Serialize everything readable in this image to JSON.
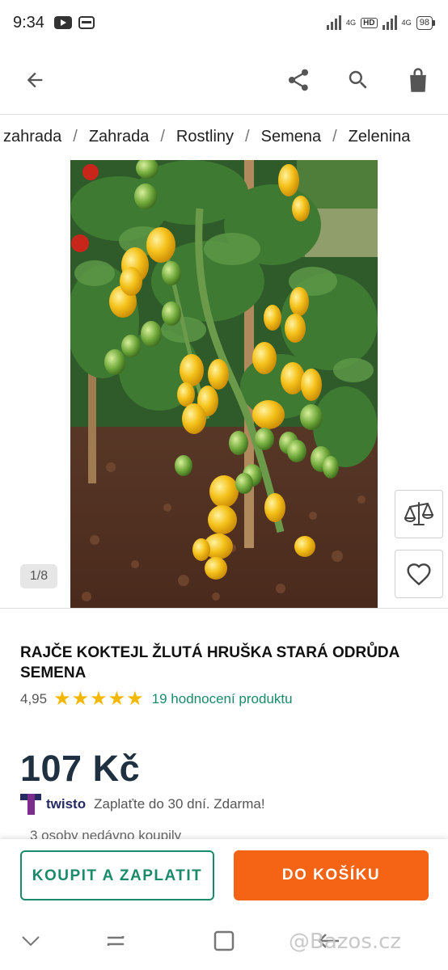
{
  "status_bar": {
    "time": "9:34",
    "network1": "4G",
    "hd": "HD",
    "network2": "4G",
    "battery": "98",
    "icons": [
      "youtube-icon",
      "message-icon",
      "signal-icon",
      "hd-icon",
      "signal-icon",
      "battery-icon"
    ]
  },
  "header": {
    "icons": [
      "back-arrow-icon",
      "share-icon",
      "search-icon",
      "shopping-bag-icon"
    ]
  },
  "breadcrumb": [
    "zahrada",
    "Zahrada",
    "Rostliny",
    "Semena",
    "Zelenina"
  ],
  "gallery": {
    "counter": "1/8"
  },
  "product": {
    "title": "RAJČE KOKTEJL ŽLUTÁ HRUŠKA STARÁ ODRŮDA SEMENA",
    "rating": "4,95",
    "stars": 5,
    "reviews": "19 hodnocení produktu",
    "price": "107 Kč",
    "twisto_brand": "twisto",
    "twisto_text": "Zaplaťte do 30 dní. Zdarma!",
    "recent_buyers": "3 osoby nedávno koupily"
  },
  "actions": {
    "buy": "KOUPIT A ZAPLATIT",
    "cart": "DO KOŠÍKU"
  },
  "colors": {
    "accent_green": "#1b8a6b",
    "cart_orange": "#f56315",
    "star_yellow": "#f5b800",
    "price_navy": "#1f3140",
    "twisto_purple": "#262b63"
  },
  "watermark": "@Bazos.cz"
}
